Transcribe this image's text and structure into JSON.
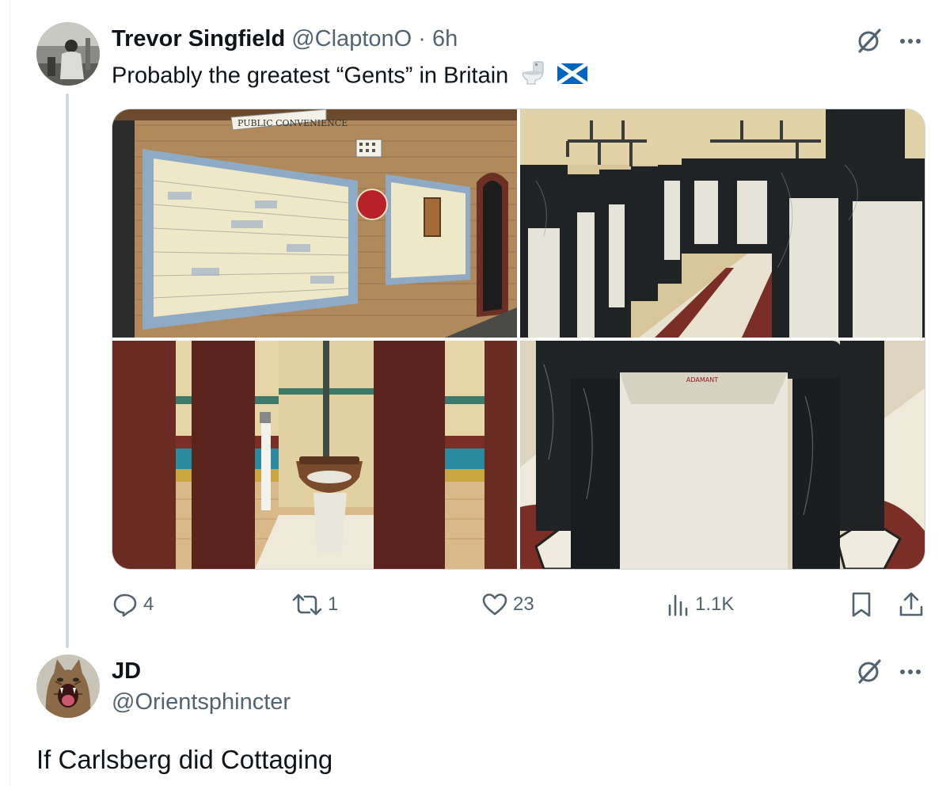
{
  "tweet1": {
    "display_name": "Trevor Singfield",
    "handle": "@ClaptonO",
    "separator": "·",
    "time": "6h",
    "text": "Probably the greatest “Gents” in Britain",
    "emojis": [
      "toilet-emoji",
      "scotland-flag-emoji"
    ],
    "sign_text": "PUBLIC CONVENIENCE",
    "stats": {
      "replies": "4",
      "reposts": "1",
      "likes": "23",
      "views": "1.1K"
    },
    "media_count": 4
  },
  "tweet2": {
    "display_name": "JD",
    "handle": "@Orientsphincter",
    "text": "If Carlsberg did Cottaging"
  },
  "colors": {
    "text": "#0f1419",
    "muted": "#536471",
    "border": "#cfd9de",
    "thread_line": "#cfd9de"
  }
}
